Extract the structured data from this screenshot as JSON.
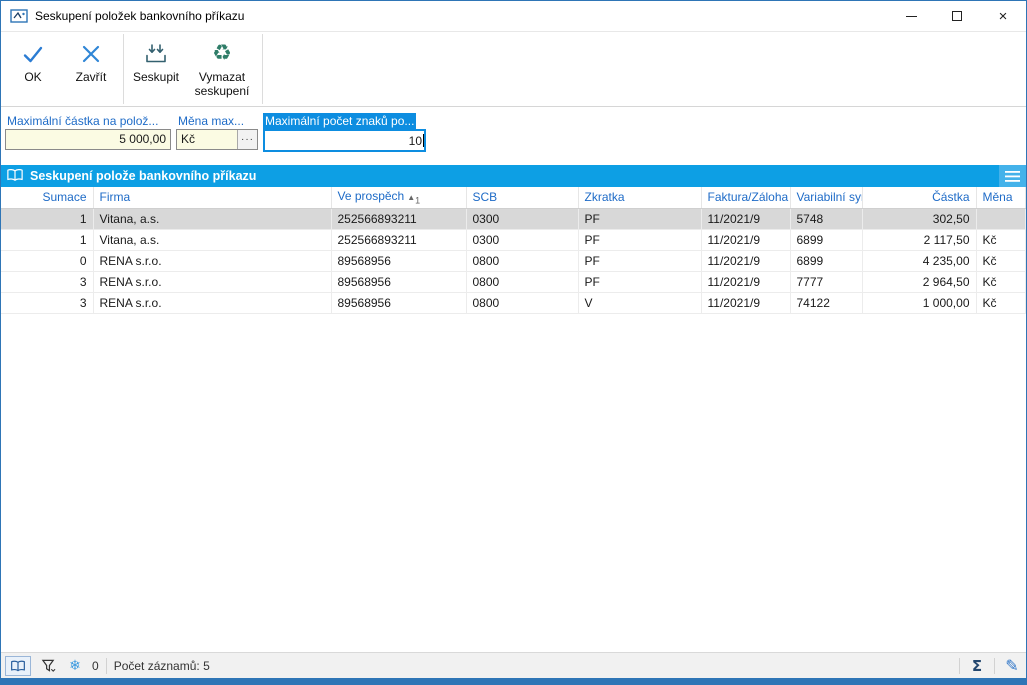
{
  "window": {
    "title": "Seskupení položek bankovního příkazu"
  },
  "icons": {
    "app": "app-icon",
    "minimize": "minimize-icon",
    "maximize": "maximize-icon",
    "close_glyph": "×",
    "picker": "···",
    "snowflake": "❄",
    "sum": "Σ",
    "edit": "✎",
    "recycle": "♻",
    "hamburger": "hamburger-icon",
    "book": "book-icon",
    "filter": "funnel-icon",
    "check": "check-icon"
  },
  "toolbar": {
    "buttons": [
      {
        "id": "ok",
        "label": "OK"
      },
      {
        "id": "zavrit",
        "label": "Zavřít"
      },
      {
        "id": "seskupit",
        "label": "Seskupit"
      },
      {
        "id": "vymazat-seskupeni",
        "label": "Vymazat seskupení"
      }
    ]
  },
  "filters": {
    "max_amount": {
      "label": "Maximální částka na polož...",
      "value": "5 000,00"
    },
    "currency": {
      "label": "Měna max...",
      "value": "Kč"
    },
    "max_chars": {
      "label": "Maximální počet znaků po...",
      "value": "10"
    }
  },
  "grid": {
    "title": "Seskupení polože bankovního příkazu",
    "columns": [
      "Sumace",
      "Firma",
      "Ve prospěch",
      "SCB",
      "Zkratka",
      "Faktura/Záloha",
      "Variabilní symb",
      "Částka",
      "Měna"
    ],
    "sort": {
      "column": "Ve prospěch",
      "indicator": "▲",
      "order": "1"
    },
    "selected_row": 0,
    "rows": [
      [
        "1",
        "Vitana, a.s.",
        "252566893211",
        "0300",
        "PF",
        "11/2021/9",
        "5748",
        "302,50",
        ""
      ],
      [
        "1",
        "Vitana, a.s.",
        "252566893211",
        "0300",
        "PF",
        "11/2021/9",
        "6899",
        "2 117,50",
        "Kč"
      ],
      [
        "0",
        "RENA s.r.o.",
        "89568956",
        "0800",
        "PF",
        "11/2021/9",
        "6899",
        "4 235,00",
        "Kč"
      ],
      [
        "3",
        "RENA s.r.o.",
        "89568956",
        "0800",
        "PF",
        "11/2021/9",
        "7777",
        "2 964,50",
        "Kč"
      ],
      [
        "3",
        "RENA s.r.o.",
        "89568956",
        "0800",
        "V",
        "11/2021/9",
        "74122",
        "1 000,00",
        "Kč"
      ]
    ]
  },
  "statusbar": {
    "frozen_count": "0",
    "record_count": "Počet záznamů: 5"
  },
  "colors": {
    "grid_titlebar": "#0d9fe4",
    "header_text": "#1e6bc7",
    "field_bg": "#fbfbe3",
    "focus_border": "#0d8de0",
    "selected_row": "#d8d8d8",
    "bottom_strip": "#2e75b6"
  }
}
